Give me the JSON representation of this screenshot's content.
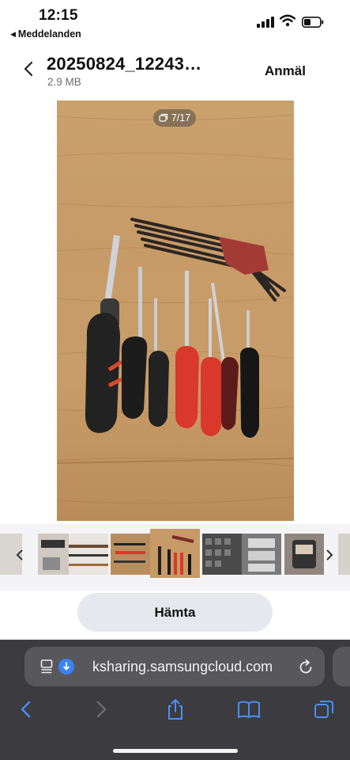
{
  "status_bar": {
    "time": "12:15",
    "back_app": "Meddelanden"
  },
  "header": {
    "file_name": "20250824_12243…",
    "file_size": "2.9 MB",
    "report_label": "Anmäl"
  },
  "viewer": {
    "counter": "7/17"
  },
  "actions": {
    "download_label": "Hämta"
  },
  "browser": {
    "url": "ksharing.samsungcloud.com"
  },
  "colors": {
    "browser_bar": "#3b3b40",
    "link_blue": "#3b82f6",
    "button_bg": "#e7e8ee"
  },
  "icons": [
    "back-chevron-icon",
    "signal-icon",
    "wifi-icon",
    "battery-icon",
    "image-stack-icon",
    "reader-icon",
    "reload-icon",
    "share-icon",
    "bookmarks-icon",
    "tabs-icon"
  ]
}
